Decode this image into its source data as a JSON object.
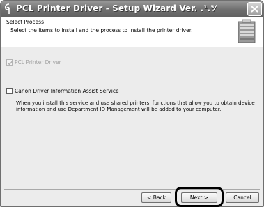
{
  "window": {
    "title": "PCL Printer Driver - Setup Wizard Ver. .¹.⁵⁄",
    "app_icon": "printer-swirl-icon",
    "close_icon": "close-icon"
  },
  "header": {
    "title": "Select Process",
    "description": "Select the items to install and the process to install the printer driver.",
    "graphic": "printer-setup-graphic"
  },
  "options": [
    {
      "label": "PCL Printer Driver",
      "checked": true,
      "enabled": false
    },
    {
      "label": "Canon Driver Information Assist Service",
      "checked": false,
      "enabled": true
    }
  ],
  "service_description": "When you install this service and use shared printers, functions that allow you to obtain device information and use Department ID Management will be added to your computer.",
  "buttons": {
    "back": "< Back",
    "next": "Next >",
    "cancel": "Cancel"
  },
  "colors": {
    "titlebar": "#6e6e6e",
    "window_bg": "#ececec",
    "highlight": "#000000"
  }
}
